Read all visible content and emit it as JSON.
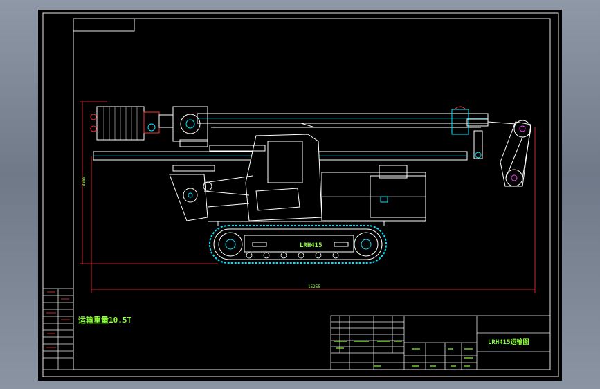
{
  "drawing": {
    "machine_model": "LRH415",
    "transport_weight_label": "运输重量10.5T",
    "title_block_name": "LRH415运输图",
    "dimensions": {
      "height": "3555",
      "length": "15255"
    }
  },
  "colors": {
    "background": "#000000",
    "lines": "#ffffff",
    "annotation": "#8dff3a",
    "cyan": "#00e5ff",
    "red": "#ff3030",
    "magenta": "#ff40ff",
    "frame": "#e8e8e8"
  }
}
